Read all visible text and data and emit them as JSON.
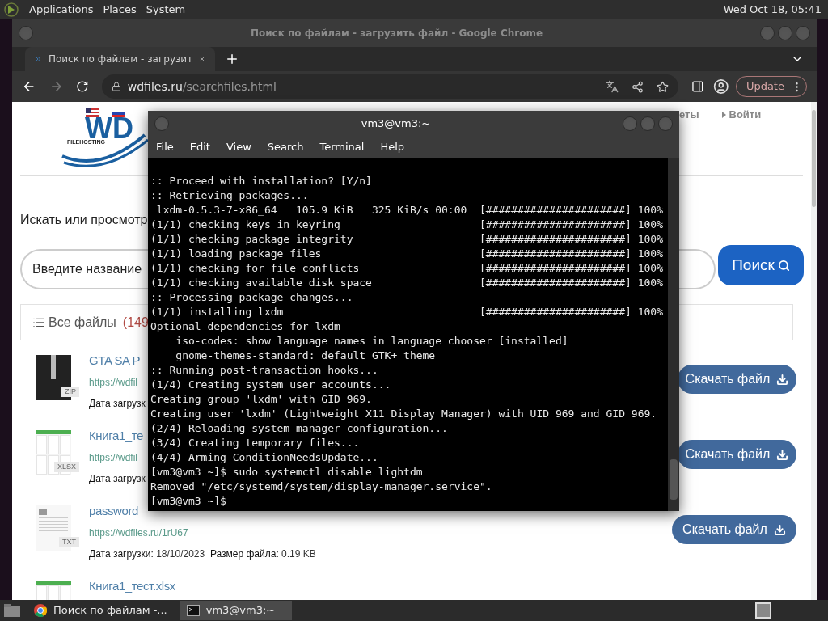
{
  "top_panel": {
    "menus": [
      "Applications",
      "Places",
      "System"
    ],
    "clock": "Wed Oct 18, 05:41"
  },
  "browser": {
    "title": "Поиск по файлам - загрузить файл - Google Chrome",
    "tabs": [
      {
        "label": "Поиск по файлам - загрузит",
        "selected": true
      }
    ],
    "url_host": "wdfiles.ru",
    "url_path": "/searchfiles.html",
    "update_button": "Update"
  },
  "page": {
    "logo_mark": "WD",
    "logo_text": "FILEHOSTING",
    "nav": [
      "еты",
      "Войти"
    ],
    "heading": "Искать или просмотр",
    "search_placeholder": "Введите название",
    "search_button": "Поиск",
    "files_tab": "Все файлы",
    "files_count": "(149",
    "files": [
      {
        "kind": "zip",
        "badge": "ZIP",
        "title": "GTA SA P",
        "url": "https://wdfil",
        "date_label": "Дата загрузк",
        "button": "Скачать файл"
      },
      {
        "kind": "xlsx",
        "badge": "XLSX",
        "title": "Книга1_те",
        "url": "https://wdfil",
        "date_label": "Дата загрузк",
        "button": "Скачать файл"
      },
      {
        "kind": "txt",
        "badge": "TXT",
        "title": "password",
        "url": "https://wdfiles.ru/1rU67",
        "date_label": "Дата загрузки:",
        "date": "18/10/2023",
        "size_label": "Размер файла:",
        "size": "0.19 KB",
        "button": "Скачать файл"
      },
      {
        "kind": "xlsx",
        "title": "Книга1_тест.xlsx"
      }
    ]
  },
  "terminal": {
    "title": "vm3@vm3:~",
    "menus": [
      "File",
      "Edit",
      "View",
      "Search",
      "Terminal",
      "Help"
    ],
    "lines": [
      {
        "kind": "plain",
        "text": ":: Proceed with installation? [Y/n]"
      },
      {
        "kind": "plain",
        "text": ":: Retrieving packages..."
      },
      {
        "kind": "progress",
        "text": " lxdm-0.5.3-7-x86_64   105.9 KiB   325 KiB/s 00:00",
        "bar": "[######################] 100%"
      },
      {
        "kind": "progress",
        "text": "(1/1) checking keys in keyring",
        "bar": "[######################] 100%"
      },
      {
        "kind": "progress",
        "text": "(1/1) checking package integrity",
        "bar": "[######################] 100%"
      },
      {
        "kind": "progress",
        "text": "(1/1) loading package files",
        "bar": "[######################] 100%"
      },
      {
        "kind": "progress",
        "text": "(1/1) checking for file conflicts",
        "bar": "[######################] 100%"
      },
      {
        "kind": "progress",
        "text": "(1/1) checking available disk space",
        "bar": "[######################] 100%"
      },
      {
        "kind": "plain",
        "text": ":: Processing package changes..."
      },
      {
        "kind": "progress",
        "text": "(1/1) installing lxdm",
        "bar": "[######################] 100%"
      },
      {
        "kind": "plain",
        "text": "Optional dependencies for lxdm"
      },
      {
        "kind": "plain",
        "text": "    iso-codes: show language names in language chooser [installed]"
      },
      {
        "kind": "plain",
        "text": "    gnome-themes-standard: default GTK+ theme"
      },
      {
        "kind": "plain",
        "text": ":: Running post-transaction hooks..."
      },
      {
        "kind": "plain",
        "text": "(1/4) Creating system user accounts..."
      },
      {
        "kind": "plain",
        "text": "Creating group 'lxdm' with GID 969."
      },
      {
        "kind": "plain",
        "text": "Creating user 'lxdm' (Lightweight X11 Display Manager) with UID 969 and GID 969."
      },
      {
        "kind": "plain",
        "text": "(2/4) Reloading system manager configuration..."
      },
      {
        "kind": "plain",
        "text": "(3/4) Creating temporary files..."
      },
      {
        "kind": "plain",
        "text": "(4/4) Arming ConditionNeedsUpdate..."
      },
      {
        "kind": "plain",
        "text": "[vm3@vm3 ~]$ sudo systemctl disable lightdm"
      },
      {
        "kind": "plain",
        "text": "Removed \"/etc/systemd/system/display-manager.service\"."
      },
      {
        "kind": "plain",
        "text": "[vm3@vm3 ~]$"
      }
    ]
  },
  "taskbar": {
    "items": [
      {
        "kind": "browser",
        "label": "Поиск по файлам -...",
        "selected": false
      },
      {
        "kind": "terminal",
        "label": "vm3@vm3:~",
        "selected": true
      }
    ]
  }
}
